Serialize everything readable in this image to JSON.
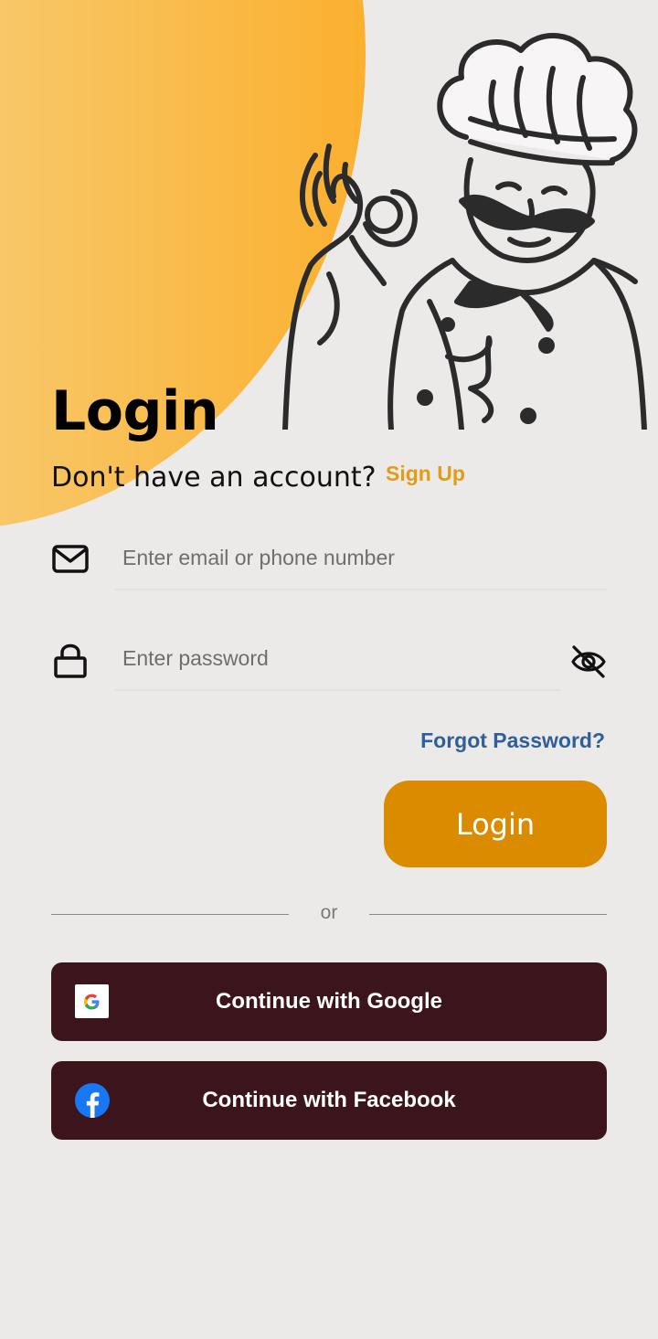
{
  "header": {
    "title": "Login",
    "signup_prompt": "Don't have an account?",
    "signup_link": "Sign Up"
  },
  "form": {
    "email": {
      "placeholder": "Enter email or phone number",
      "value": ""
    },
    "password": {
      "placeholder": "Enter password",
      "value": ""
    },
    "forgot_label": "Forgot Password?",
    "login_label": "Login"
  },
  "divider": {
    "label": "or"
  },
  "social": {
    "google_label": "Continue with Google",
    "facebook_label": "Continue with Facebook"
  },
  "colors": {
    "accent": "#db8b00",
    "link_orange": "#e29c16",
    "link_blue": "#2f5f9b",
    "social_bg": "#3c151c",
    "background": "#ece9e9"
  },
  "icons": [
    "mail-icon",
    "lock-icon",
    "eye-off-icon",
    "google-icon",
    "facebook-icon",
    "chef-illustration"
  ]
}
